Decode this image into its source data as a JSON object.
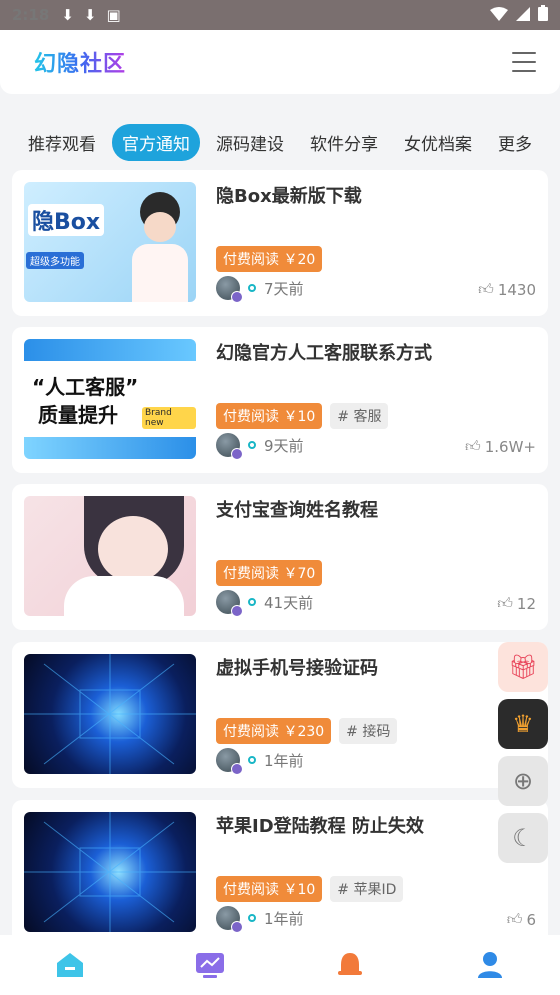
{
  "status": {
    "time": "2:18"
  },
  "app": {
    "logo": "幻隐社区"
  },
  "tabs": [
    {
      "label": "推荐观看",
      "active": false
    },
    {
      "label": "官方通知",
      "active": true
    },
    {
      "label": "源码建设",
      "active": false
    },
    {
      "label": "软件分享",
      "active": false
    },
    {
      "label": "女优档案",
      "active": false
    },
    {
      "label": "更多",
      "active": false
    }
  ],
  "posts": [
    {
      "title": "隐Box最新版下载",
      "price": "付费阅读 ￥20",
      "tag": "",
      "time": "7天前",
      "likes": "1430",
      "thumb": {
        "main": "隐Box",
        "sub": "超级多功能"
      }
    },
    {
      "title": "幻隐官方人工客服联系方式",
      "price": "付费阅读 ￥10",
      "tag": "# 客服",
      "time": "9天前",
      "likes": "1.6W+",
      "thumb": {
        "line1": "“人工客服”",
        "line2": "质量提升",
        "badge": "Brand new"
      }
    },
    {
      "title": "支付宝查询姓名教程",
      "price": "付费阅读 ￥70",
      "tag": "",
      "time": "41天前",
      "likes": "12"
    },
    {
      "title": "虚拟手机号接验证码",
      "price": "付费阅读 ￥230",
      "tag": "# 接码",
      "time": "1年前",
      "likes": ""
    },
    {
      "title": "苹果ID登陆教程 防止失效",
      "price": "付费阅读 ￥10",
      "tag": "# 苹果ID",
      "time": "1年前",
      "likes": "6"
    }
  ],
  "colors": {
    "accent": "#1ea3dc",
    "price": "#f08b3a",
    "crown_bg": "#2b2b2b",
    "gift_bg": "#fde3dc"
  }
}
